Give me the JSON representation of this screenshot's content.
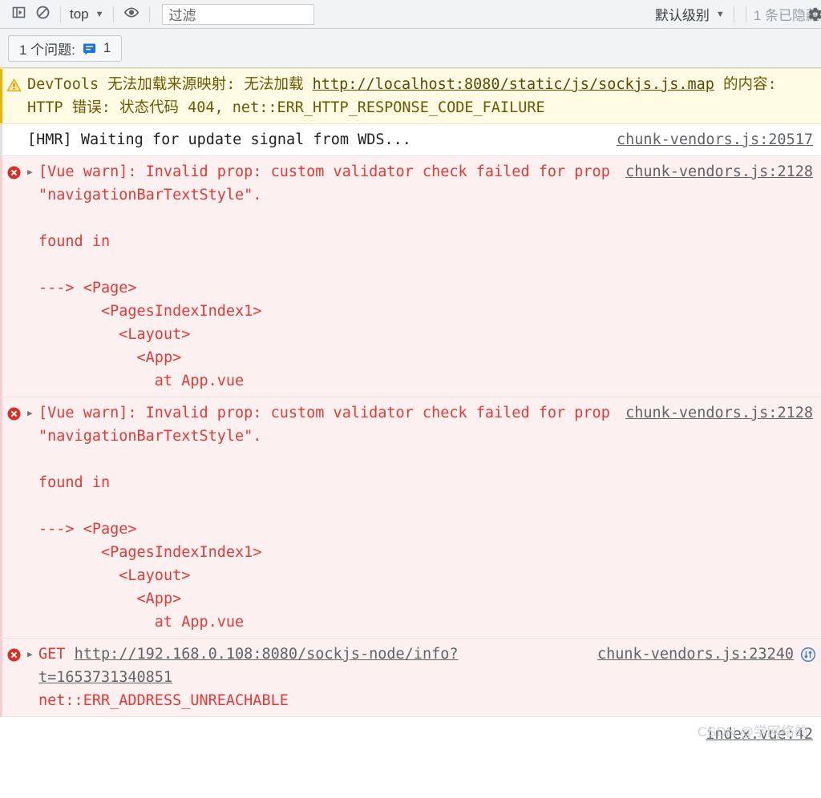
{
  "toolbar": {
    "sidebar_toggle_title": "显示控制台侧边栏",
    "clear_title": "清除控制台",
    "context_selector": "top",
    "context_caret": "▼",
    "eye_title": "创建实时表达式",
    "filter_placeholder": "过滤",
    "filter_value": "",
    "level_selector": "默认级别",
    "level_caret": "▼",
    "hidden_count": "1 条已隐藏",
    "settings_title": "控制台设置"
  },
  "issues": {
    "label": "1 个问题:",
    "count": "1"
  },
  "colors": {
    "error": "#e53935",
    "warning": "#f0b400",
    "issue_blue": "#1a73e8",
    "link": "#5f6368",
    "toolbar_bg": "#f1f3f4",
    "error_bg": "#fdf0f0",
    "warn_bg": "#fffbe5"
  },
  "console_rows": [
    {
      "level": "warning",
      "icon": "warning-triangle-icon",
      "text_a": "DevTools 无法加载来源映射: 无法加载 ",
      "link_a": "http://localhost:8080/static/js/sockjs.js.map",
      "text_b": " 的内容: HTTP 错误: 状态代码 404, net::ERR_HTTP_RESPONSE_CODE_FAILURE",
      "source": ""
    },
    {
      "level": "info",
      "icon": "",
      "text": "[HMR] Waiting for update signal from WDS...",
      "source": "chunk-vendors.js:20517"
    },
    {
      "level": "error",
      "icon": "error-circle-icon",
      "expander": "▶",
      "text": "[Vue warn]: Invalid prop: custom validator check failed for prop \"navigationBarTextStyle\".\n\nfound in\n\n---> <Page>\n       <PagesIndexIndex1>\n         <Layout>\n           <App>\n             at App.vue",
      "source": "chunk-vendors.js:2128"
    },
    {
      "level": "error",
      "icon": "error-circle-icon",
      "expander": "▶",
      "text": "[Vue warn]: Invalid prop: custom validator check failed for prop \"navigationBarTextStyle\".\n\nfound in\n\n---> <Page>\n       <PagesIndexIndex1>\n         <Layout>\n           <App>\n             at App.vue",
      "source": "chunk-vendors.js:2128"
    },
    {
      "level": "error",
      "icon": "error-circle-icon",
      "expander": "▶",
      "method": "GET",
      "url": "http://192.168.0.108:8080/sockjs-node/info?t=1653731340851",
      "reason": "net::ERR_ADDRESS_UNREACHABLE",
      "source": "chunk-vendors.js:23240",
      "network_icon": "network-request-icon"
    }
  ],
  "footer": {
    "source": "index.vue:42",
    "watermark": "CSDN @学网络的"
  }
}
